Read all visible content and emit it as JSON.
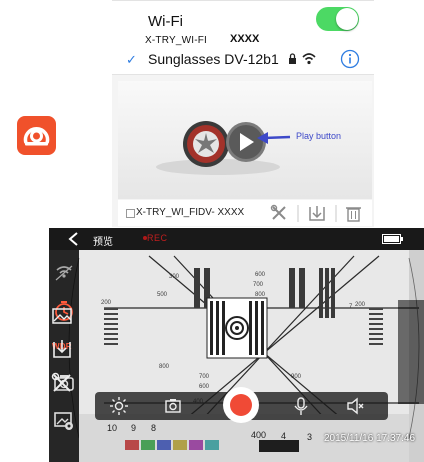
{
  "wifi": {
    "title": "Wi-Fi",
    "toggle_on": true,
    "subtitle_ssid": "X-TRY_WI-FI",
    "subtitle_name": "XXXX",
    "connected_network": "Sunglasses DV-12b1",
    "accent": "#4cd964",
    "check_color": "#2f7de1"
  },
  "app_icon": {
    "name": "camera-app-icon",
    "color": "#f0512b"
  },
  "video_card": {
    "play_label": "Play button",
    "footer_name": "X-TRY_WI_FIDV- XXXX",
    "icons": [
      "settings-icon",
      "download-icon",
      "delete-icon"
    ]
  },
  "camera": {
    "back_icon": "chevron-left-icon",
    "preview_label": "预览",
    "rec_label": "REC",
    "battery_icon": "battery-icon",
    "timestamp": "2015/11/16  17:37:46",
    "left_icons": [
      "wifi-signal-icon",
      "timer-icon",
      "wdr-icon",
      "camera-switch-icon",
      "photo-settings-icon"
    ],
    "wdr_label": "WDR",
    "right_icons": [
      "gallery-icon",
      "download-icon",
      "settings-icon"
    ],
    "bottom_controls": [
      "brightness-icon",
      "snapshot-icon",
      "record-button",
      "microphone-icon",
      "speaker-icon"
    ],
    "rec_color": "#f04a36"
  }
}
